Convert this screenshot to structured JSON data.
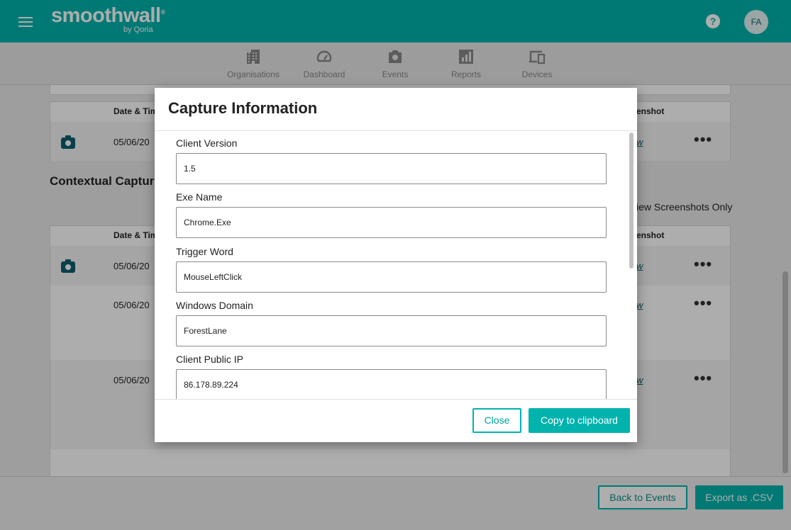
{
  "brand": {
    "name": "smoothwall",
    "trademark": "®",
    "subtitle": "by Qoria"
  },
  "header": {
    "help_glyph": "?",
    "avatar_initials": "FA"
  },
  "nav": {
    "items": [
      {
        "label": "Organisations",
        "icon": "building-icon"
      },
      {
        "label": "Dashboard",
        "icon": "speedometer-icon"
      },
      {
        "label": "Events",
        "icon": "camera-icon"
      },
      {
        "label": "Reports",
        "icon": "bar-chart-icon"
      },
      {
        "label": "Devices",
        "icon": "devices-icon"
      }
    ]
  },
  "background": {
    "table1": {
      "col_date": "Date & Time",
      "col_screenshot": "enshot",
      "row_date": "05/06/20",
      "row_link": "w"
    },
    "section_title": "Contextual Capture",
    "view_screenshots_only": "iew Screenshots Only",
    "table2": {
      "col_date": "Date & Time",
      "col_screenshot": "enshot",
      "rows": [
        {
          "date": "05/06/20",
          "link": "w"
        },
        {
          "date": "05/06/20",
          "link": "w"
        },
        {
          "date": "05/06/20",
          "link": "w"
        }
      ]
    },
    "row_menu_glyph": "•••"
  },
  "footer": {
    "back_label": "Back to Events",
    "export_label": "Export as .CSV"
  },
  "modal": {
    "title": "Capture Information",
    "fields": [
      {
        "label": "Client Version",
        "value": "1.5"
      },
      {
        "label": "Exe Name",
        "value": "Chrome.Exe"
      },
      {
        "label": "Trigger Word",
        "value": "MouseLeftClick"
      },
      {
        "label": "Windows Domain",
        "value": "ForestLane"
      },
      {
        "label": "Client Public IP",
        "value": "86.178.89.224"
      }
    ],
    "close_label": "Close",
    "copy_label": "Copy to clipboard"
  },
  "colors": {
    "accent": "#00b3ad",
    "dark_teal": "#0d5f6e"
  }
}
